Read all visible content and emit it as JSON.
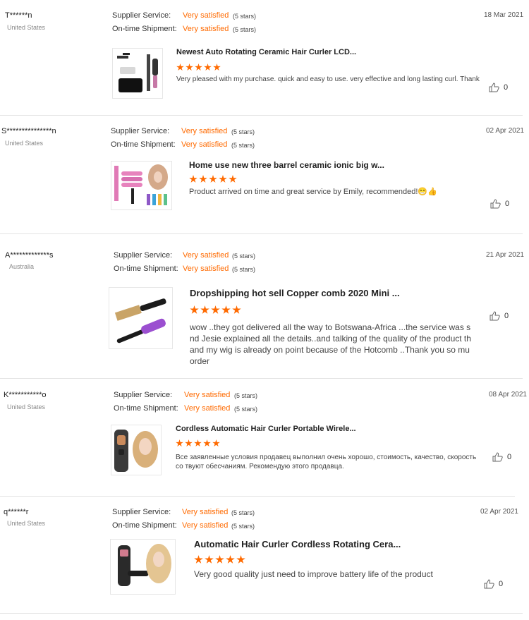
{
  "labels": {
    "supplier_service": "Supplier Service:",
    "ontime_shipment": "On-time Shipment:"
  },
  "colors": {
    "accent": "#ff6a00",
    "divider": "#e3e3e3"
  },
  "reviews": [
    {
      "name": "T******n",
      "country": "United States",
      "date": "18 Mar 2021",
      "supplier_value": "Very satisfied",
      "supplier_note": "(5 stars)",
      "shipment_value": "Very satisfied",
      "shipment_note": "(5 stars)",
      "product_title": "Newest Auto Rotating Ceramic Hair Curler LCD...",
      "stars": 5,
      "text": "Very pleased with my purchase. quick and easy to use. very effective and long lasting curl. Thank you",
      "likes": "0",
      "icon": "thumbs-up-icon"
    },
    {
      "name": "S***************n",
      "country": "United States",
      "date": "02 Apr 2021",
      "supplier_value": "Very satisfied",
      "supplier_note": "(5 stars)",
      "shipment_value": "Very satisfied",
      "shipment_note": "(5 stars)",
      "product_title": "Home use new three barrel ceramic ionic big w...",
      "stars": 5,
      "text": "Product arrived on time and great service by Emily, recommended!😁👍",
      "likes": "0",
      "icon": "thumbs-up-icon"
    },
    {
      "name": "A*************s",
      "country": "Australia",
      "date": "21 Apr 2021",
      "supplier_value": "Very satisfied",
      "supplier_note": "(5 stars)",
      "shipment_value": "Very satisfied",
      "shipment_note": "(5 stars)",
      "product_title": "Dropshipping hot sell Copper comb 2020 Mini ...",
      "stars": 5,
      "text": "wow ..they got delivered all the way to Botswana-Africa ...the service was s nd Jesie explained all the details..and talking of the quality of the product th and my wig is already on point because of the Hotcomb ..Thank you so mu order",
      "likes": "0",
      "icon": "thumbs-up-icon"
    },
    {
      "name": "K***********o",
      "country": "United States",
      "date": "08 Apr 2021",
      "supplier_value": "Very satisfied",
      "supplier_note": "(5 stars)",
      "shipment_value": "Very satisfied",
      "shipment_note": "(5 stars)",
      "product_title": "Cordless Automatic Hair Curler Portable Wirele...",
      "stars": 5,
      "text": "Все заявленные условия продавец выполнил очень хорошо, стоимость, качество, скорость со твуют обесчаниям. Рекомендую этого продавца.",
      "likes": "0",
      "icon": "thumbs-up-icon"
    },
    {
      "name": "q******r",
      "country": "United States",
      "date": "02 Apr 2021",
      "supplier_value": "Very satisfied",
      "supplier_note": "(5 stars)",
      "shipment_value": "Very satisfied",
      "shipment_note": "(5 stars)",
      "product_title": "Automatic Hair Curler Cordless Rotating Cera...",
      "stars": 5,
      "text": "Very good quality just need to improve battery life of the product",
      "likes": "0",
      "icon": "thumbs-up-icon"
    }
  ]
}
